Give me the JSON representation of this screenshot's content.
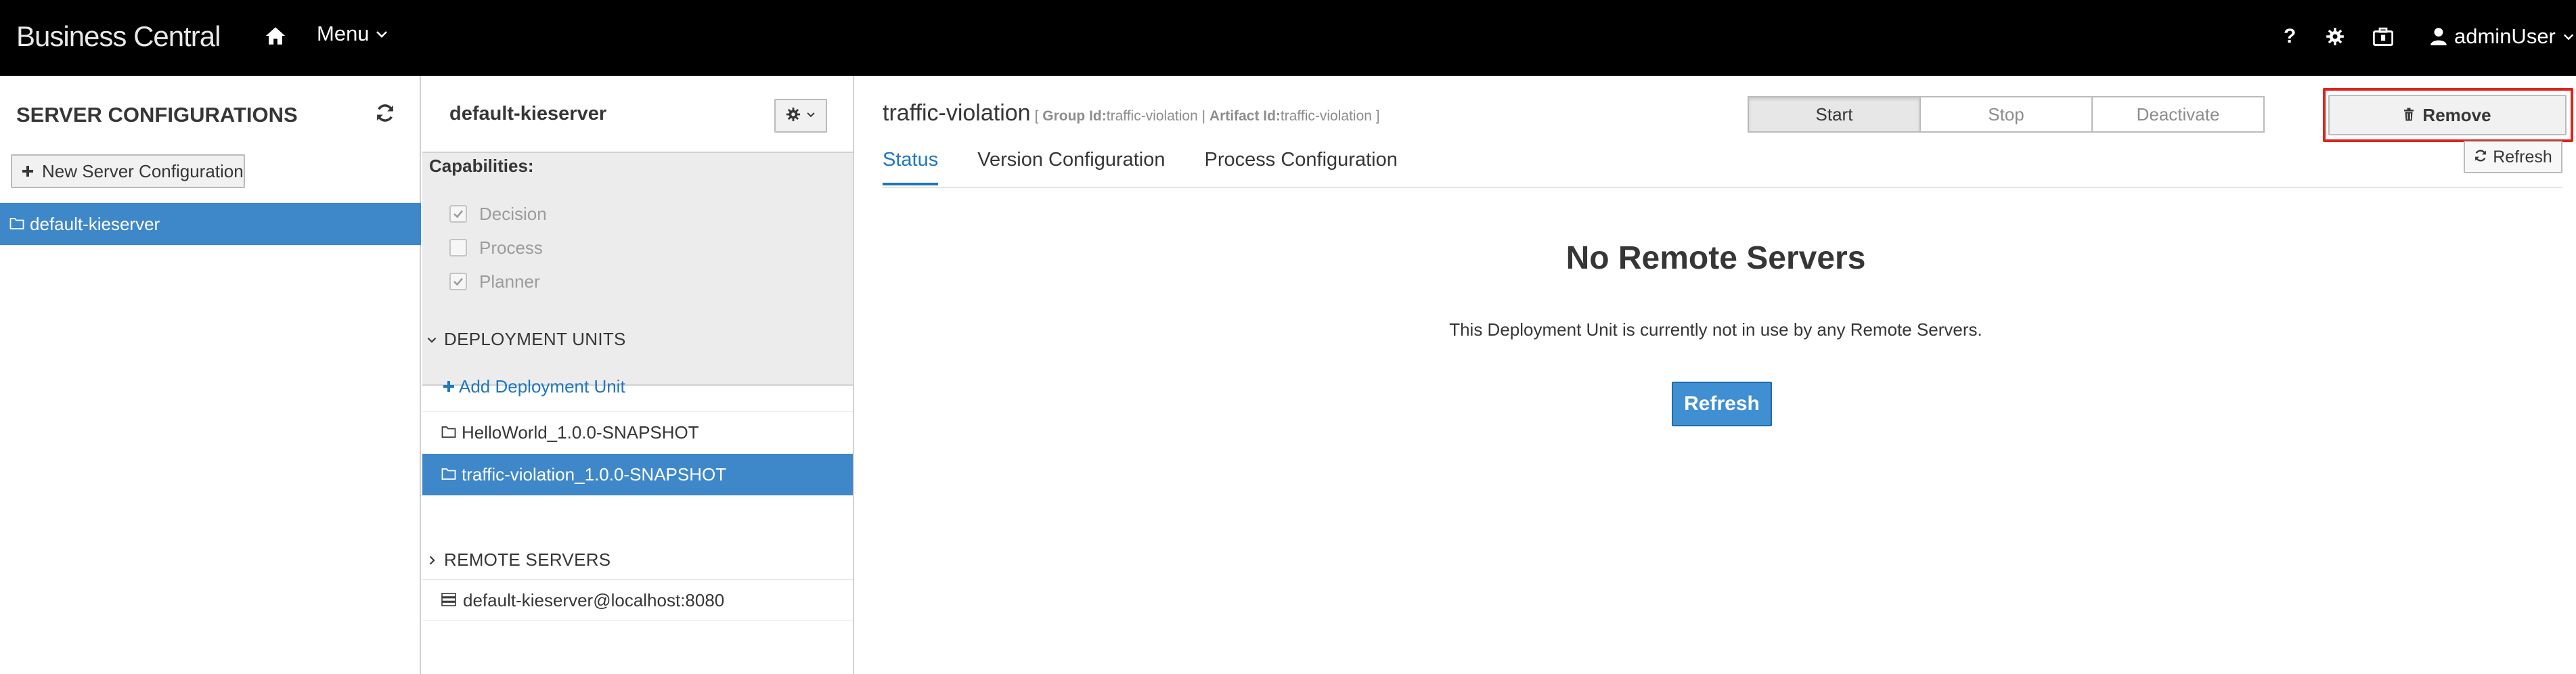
{
  "navbar": {
    "brand": "Business Central",
    "menu_label": "Menu",
    "help_label": "?",
    "user_name": "adminUser"
  },
  "servers": {
    "title": "SERVER CONFIGURATIONS",
    "new_button": "New Server Configuration",
    "items": [
      {
        "label": "default-kieserver",
        "selected": true
      }
    ]
  },
  "server_detail": {
    "title": "default-kieserver",
    "capabilities_label": "Capabilities:",
    "capabilities": [
      {
        "label": "Decision",
        "checked": true
      },
      {
        "label": "Process",
        "checked": false
      },
      {
        "label": "Planner",
        "checked": true
      }
    ],
    "deployment_units_header": "DEPLOYMENT UNITS",
    "add_deployment_unit": "Add Deployment Unit",
    "deployment_units": [
      {
        "label": "HelloWorld_1.0.0-SNAPSHOT",
        "selected": false
      },
      {
        "label": "traffic-violation_1.0.0-SNAPSHOT",
        "selected": true
      }
    ],
    "remote_servers_header": "REMOTE SERVERS",
    "remote_servers": [
      {
        "label": "default-kieserver@localhost:8080"
      }
    ]
  },
  "main": {
    "du_name": "traffic-violation",
    "meta_open": "[",
    "group_label": "Group Id:",
    "group_value": "traffic-violation",
    "sep": "|",
    "artifact_label": "Artifact Id:",
    "artifact_value": "traffic-violation",
    "meta_close": "]",
    "actions": {
      "start": "Start",
      "stop": "Stop",
      "deactivate": "Deactivate",
      "remove": "Remove"
    },
    "tabs": [
      {
        "label": "Status",
        "active": true
      },
      {
        "label": "Version Configuration",
        "active": false
      },
      {
        "label": "Process Configuration",
        "active": false
      }
    ],
    "refresh_small": "Refresh",
    "empty_title": "No Remote Servers",
    "empty_text": "This Deployment Unit is currently not in use by any Remote Servers.",
    "refresh_primary": "Refresh"
  },
  "colors": {
    "navbar_bg": "#000000",
    "selection_blue": "#3e87c9",
    "link_blue": "#1f76c2",
    "highlight_red": "#e0241b"
  }
}
